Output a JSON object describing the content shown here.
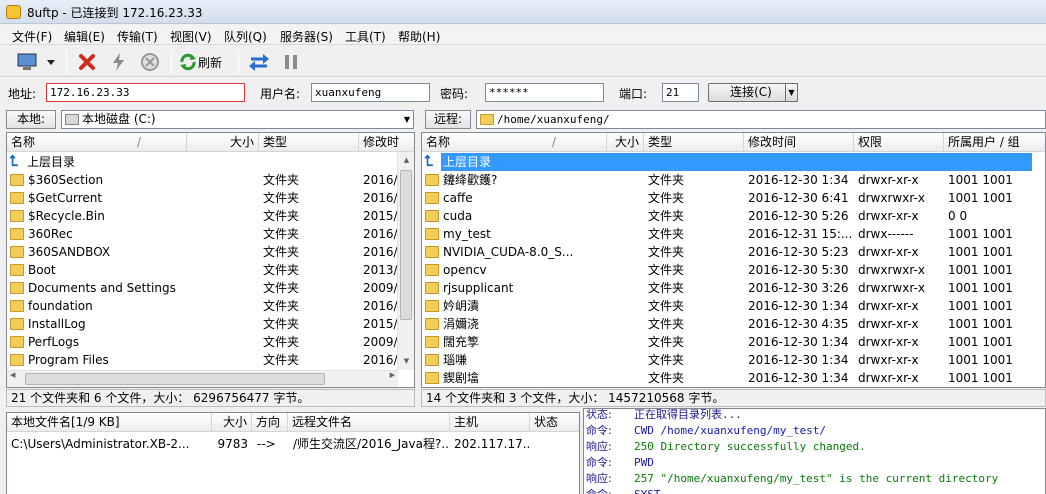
{
  "window": {
    "title": "8uftp - 已连接到 172.16.23.33"
  },
  "menu": [
    "文件(F)",
    "编辑(E)",
    "传输(T)",
    "视图(V)",
    "队列(Q)",
    "服务器(S)",
    "工具(T)",
    "帮助(H)"
  ],
  "toolbar": {
    "refresh_label": "刷新"
  },
  "address": {
    "host_label": "地址:",
    "host_value": "172.16.23.33",
    "user_label": "用户名:",
    "user_value": "xuanxufeng",
    "pass_label": "密码:",
    "pass_value": "******",
    "port_label": "端口:",
    "port_value": "21",
    "connect_label": "连接(C)"
  },
  "local": {
    "tab_label": "本地:",
    "path": "本地磁盘 (C:)",
    "columns": [
      "名称",
      "大小",
      "类型",
      "修改时"
    ],
    "up_label": "上层目录",
    "rows": [
      {
        "name": "$360Section",
        "type": "文件夹",
        "date": "2016/8"
      },
      {
        "name": "$GetCurrent",
        "type": "文件夹",
        "date": "2016/("
      },
      {
        "name": "$Recycle.Bin",
        "type": "文件夹",
        "date": "2015/1"
      },
      {
        "name": "360Rec",
        "type": "文件夹",
        "date": "2016/1"
      },
      {
        "name": "360SANDBOX",
        "type": "文件夹",
        "date": "2016/1"
      },
      {
        "name": "Boot",
        "type": "文件夹",
        "date": "2013/1"
      },
      {
        "name": "Documents and Settings",
        "type": "文件夹",
        "date": "2009/7"
      },
      {
        "name": "foundation",
        "type": "文件夹",
        "date": "2016/1"
      },
      {
        "name": "InstallLog",
        "type": "文件夹",
        "date": "2015/1"
      },
      {
        "name": "PerfLogs",
        "type": "文件夹",
        "date": "2009/7"
      },
      {
        "name": "Program Files",
        "type": "文件夹",
        "date": "2016/1"
      }
    ],
    "status": "21 个文件夹和 6 个文件，大小： 6296756477 字节。"
  },
  "remote": {
    "tab_label": "远程:",
    "path": "/home/xuanxufeng/",
    "columns": [
      "名称",
      "大小",
      "类型",
      "修改时间",
      "权限",
      "所属用户 / 组"
    ],
    "up_label": "上层目录",
    "rows": [
      {
        "name": "鑳绛歡鑊?",
        "type": "文件夹",
        "date": "2016-12-30 1:34",
        "perm": "drwxr-xr-x",
        "owner": "1001 1001"
      },
      {
        "name": "caffe",
        "type": "文件夹",
        "date": "2016-12-30 6:41",
        "perm": "drwxrwxr-x",
        "owner": "1001 1001"
      },
      {
        "name": "cuda",
        "type": "文件夹",
        "date": "2016-12-30 5:26",
        "perm": "drwxr-xr-x",
        "owner": "0 0"
      },
      {
        "name": "my_test",
        "type": "文件夹",
        "date": "2016-12-31 15:...",
        "perm": "drwx------",
        "owner": "1001 1001"
      },
      {
        "name": "NVIDIA_CUDA-8.0_S...",
        "type": "文件夹",
        "date": "2016-12-30 5:23",
        "perm": "drwxr-xr-x",
        "owner": "1001 1001"
      },
      {
        "name": "opencv",
        "type": "文件夹",
        "date": "2016-12-30 5:30",
        "perm": "drwxrwxr-x",
        "owner": "1001 1001"
      },
      {
        "name": "rjsupplicant",
        "type": "文件夹",
        "date": "2016-12-30 3:26",
        "perm": "drwxrwxr-x",
        "owner": "1001 1001"
      },
      {
        "name": "妗岄潰",
        "type": "文件夹",
        "date": "2016-12-30 1:34",
        "perm": "drwxr-xr-x",
        "owner": "1001 1001"
      },
      {
        "name": "涓嬭浇",
        "type": "文件夹",
        "date": "2016-12-30 4:35",
        "perm": "drwxr-xr-x",
        "owner": "1001 1001"
      },
      {
        "name": "闊充箰",
        "type": "文件夹",
        "date": "2016-12-30 1:34",
        "perm": "drwxr-xr-x",
        "owner": "1001 1001"
      },
      {
        "name": "瑙嗛",
        "type": "文件夹",
        "date": "2016-12-30 1:34",
        "perm": "drwxr-xr-x",
        "owner": "1001 1001"
      },
      {
        "name": "鍥剧墖",
        "type": "文件夹",
        "date": "2016-12-30 1:34",
        "perm": "drwxr-xr-x",
        "owner": "1001 1001"
      }
    ],
    "status": "14 个文件夹和 3 个文件，大小： 1457210568 字节。"
  },
  "queue": {
    "columns": [
      "本地文件名[1/9 KB]",
      "大小",
      "方向",
      "远程文件名",
      "主机",
      "状态"
    ],
    "rows": [
      {
        "local": "C:\\Users\\Administrator.XB-2...",
        "size": "9783",
        "dir": "-->",
        "remote": "/师生交流区/2016_Java程?...",
        "host": "202.117.17...",
        "status": ""
      }
    ]
  },
  "log": [
    {
      "label": "状态:",
      "text": "正在取得目录列表...",
      "color": "#1a1a8a"
    },
    {
      "label": "命令:",
      "text": "CWD /home/xuanxufeng/my_test/",
      "color": "#1a1aa8"
    },
    {
      "label": "响应:",
      "text": "250 Directory successfully changed.",
      "color": "#0a7a0a"
    },
    {
      "label": "命令:",
      "text": "PWD",
      "color": "#1a1aa8"
    },
    {
      "label": "响应:",
      "text": "257 \"/home/xuanxufeng/my_test\" is the current directory",
      "color": "#0a7a0a"
    },
    {
      "label": "命令:",
      "text": "SYST",
      "color": "#1a1aa8"
    }
  ]
}
